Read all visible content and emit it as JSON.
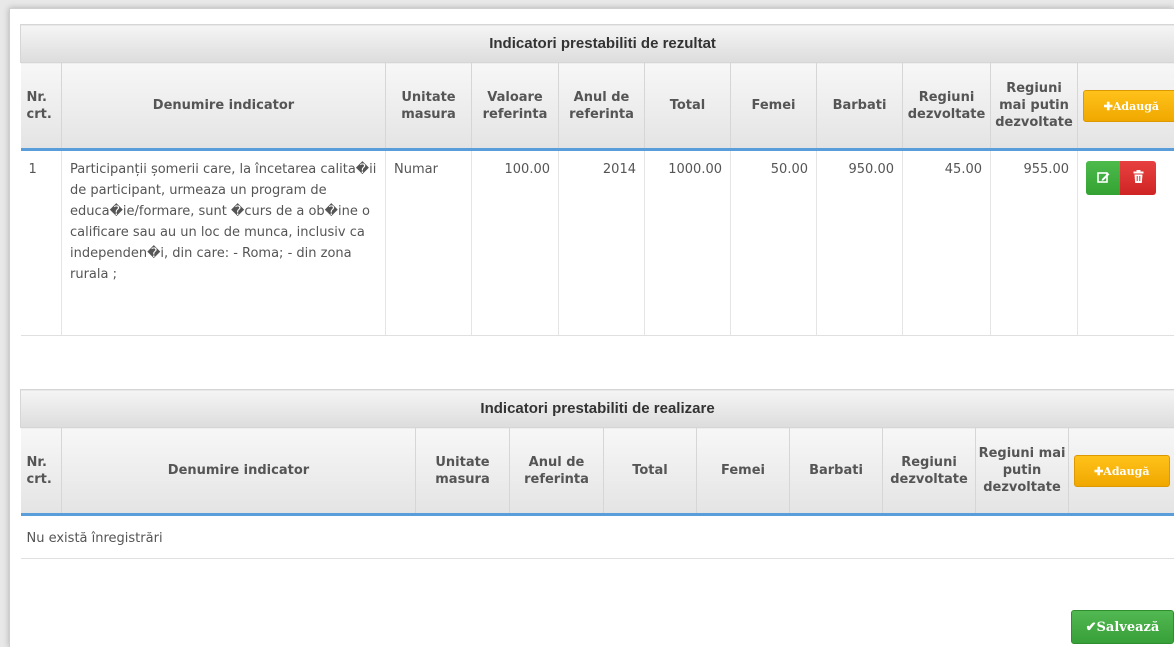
{
  "result_table": {
    "title": "Indicatori prestabiliti de rezultat",
    "columns": {
      "nr": "Nr. crt.",
      "name": "Denumire indicator",
      "unit": "Unitate masura",
      "ref_value": "Valoare referinta",
      "ref_year": "Anul de referinta",
      "total": "Total",
      "women": "Femei",
      "men": "Barbati",
      "developed": "Regiuni dezvoltate",
      "less_developed": "Regiuni mai putin dezvoltate"
    },
    "add_label": "✚Adaugă",
    "rows": [
      {
        "nr": "1",
        "name": "Participanții șomerii care, la încetarea calita�ii de participant, urmeaza un program de educa�ie/formare, sunt �curs de a ob�ine o calificare sau au un loc de munca, inclusiv ca independen�i, din care: - Roma; - din zona rurala ;",
        "unit": "Numar",
        "ref_value": "100.00",
        "ref_year": "2014",
        "total": "1000.00",
        "women": "50.00",
        "men": "950.00",
        "developed": "45.00",
        "less_developed": "955.00"
      }
    ],
    "edit_icon": "edit-icon",
    "delete_icon": "trash-icon"
  },
  "output_table": {
    "title": "Indicatori prestabiliti de realizare",
    "columns": {
      "nr": "Nr. crt.",
      "name": "Denumire indicator",
      "unit": "Unitate masura",
      "ref_year": "Anul de referinta",
      "total": "Total",
      "women": "Femei",
      "men": "Barbati",
      "developed": "Regiuni dezvoltate",
      "less_developed": "Regiuni mai putin dezvoltate"
    },
    "add_label": "✚Adaugă",
    "empty_text": "Nu există înregistrări"
  },
  "save_label": "✔Salvează",
  "colors": {
    "header_border": "#5a9ddb",
    "add_button": "#f0a800",
    "edit_button": "#3aa83a",
    "delete_button": "#d62c2c",
    "save_button": "#3fa53f"
  }
}
